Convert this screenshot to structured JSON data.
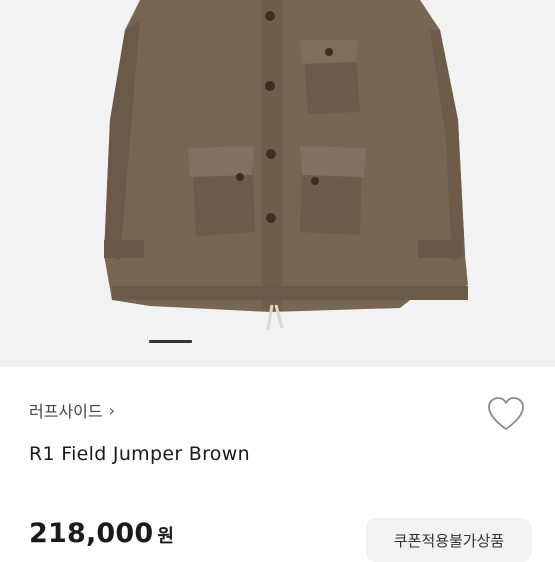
{
  "product": {
    "brand_link": "러프사이드",
    "brand_chevron": "›",
    "title": "R1 Field Jumper Brown",
    "price": "218,000",
    "currency": "원",
    "coupon_badge": "쿠폰적용불가상품"
  },
  "gallery": {
    "image_subject": "brown field jacket photo",
    "active_index": 1,
    "jacket_color": "#7a6a55"
  },
  "icons": {
    "wishlist": "heart-outline-icon",
    "brand_arrow": "chevron-right-icon"
  }
}
